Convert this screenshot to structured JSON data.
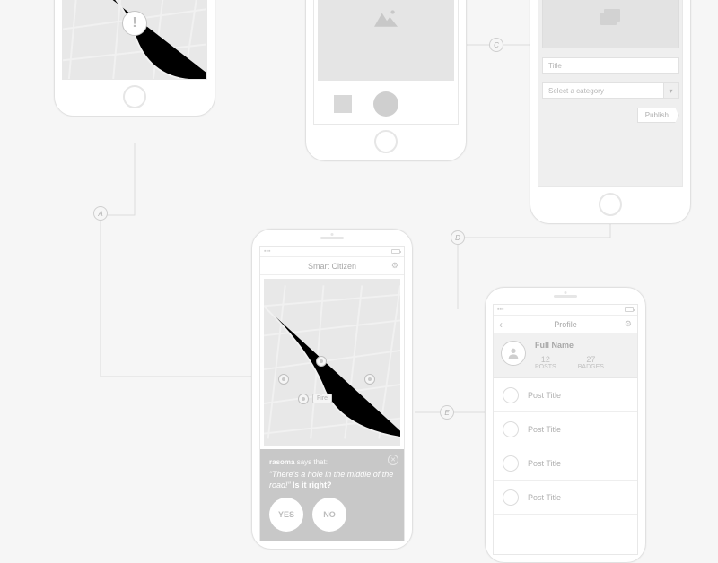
{
  "flow_labels": {
    "A": "A",
    "C": "C",
    "D": "D",
    "E": "E"
  },
  "alert": {
    "glyph": "!"
  },
  "compose": {
    "title_placeholder": "Title",
    "category_placeholder": "Select a category",
    "publish_label": "Publish"
  },
  "main": {
    "app_title": "Smart Citizen",
    "pin_label": "Fire",
    "reporter": "rasoma",
    "meta_says": " says that:",
    "quote": "“There's a hole in the middle of the road!”",
    "prompt": " Is it right?",
    "yes": "YES",
    "no": "NO"
  },
  "profile": {
    "title": "Profile",
    "full_name": "Full Name",
    "posts_count": "12",
    "posts_label": "POSTS",
    "badges_count": "27",
    "badges_label": "BADGES",
    "rows": [
      "Post Title",
      "Post Title",
      "Post Title",
      "Post Title"
    ]
  }
}
